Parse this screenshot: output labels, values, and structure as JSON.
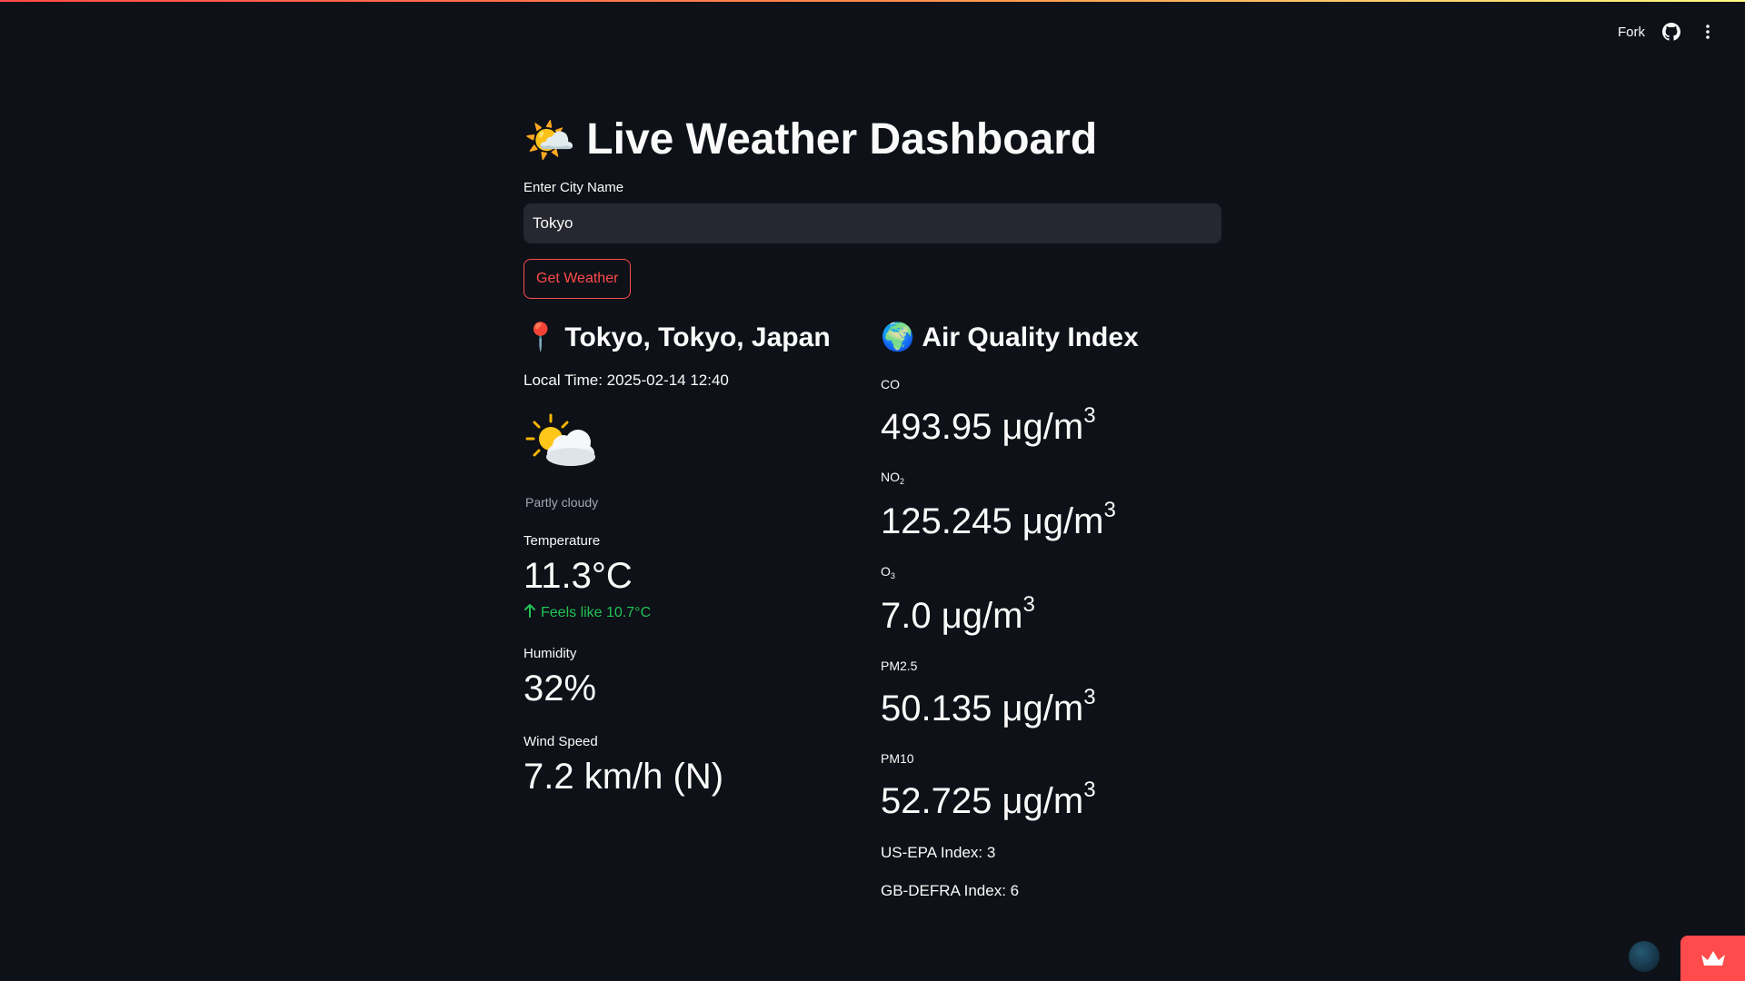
{
  "toolbar": {
    "fork_label": "Fork",
    "github_icon": "github-icon",
    "menu_icon": "kebab-menu-icon"
  },
  "header": {
    "emoji": "🌤️",
    "title": "Live Weather Dashboard"
  },
  "search": {
    "label": "Enter City Name",
    "value": "Tokyo",
    "button_label": "Get Weather"
  },
  "location": {
    "emoji": "📍",
    "heading": "Tokyo, Tokyo, Japan",
    "local_time": "Local Time: 2025-02-14 12:40",
    "condition_icon": "partly-cloudy-icon",
    "condition": "Partly cloudy"
  },
  "metrics": {
    "temperature": {
      "label": "Temperature",
      "value": "11.3°C",
      "delta": "Feels like 10.7°C",
      "delta_direction": "up"
    },
    "humidity": {
      "label": "Humidity",
      "value": "32%"
    },
    "wind": {
      "label": "Wind Speed",
      "value": "7.2 km/h (N)"
    }
  },
  "air_quality": {
    "emoji": "🌍",
    "heading": "Air Quality Index",
    "unit": "μg/m",
    "unit_sup": "3",
    "items": [
      {
        "label": "CO",
        "label_base": "CO",
        "label_sub": "",
        "value": "493.95"
      },
      {
        "label": "NO₂",
        "label_base": "NO",
        "label_sub": "2",
        "value": "125.245"
      },
      {
        "label": "O₃",
        "label_base": "O",
        "label_sub": "3",
        "value": "7.0"
      },
      {
        "label": "PM2.5",
        "label_base": "PM2.5",
        "label_sub": "",
        "value": "50.135"
      },
      {
        "label": "PM10",
        "label_base": "PM10",
        "label_sub": "",
        "value": "52.725"
      }
    ],
    "us_epa": "US-EPA Index: 3",
    "gb_defra": "GB-DEFRA Index: 6"
  },
  "colors": {
    "background": "#0e1117",
    "accent": "#ff4b4b",
    "input_bg": "#262730",
    "delta_positive": "#21c354"
  }
}
